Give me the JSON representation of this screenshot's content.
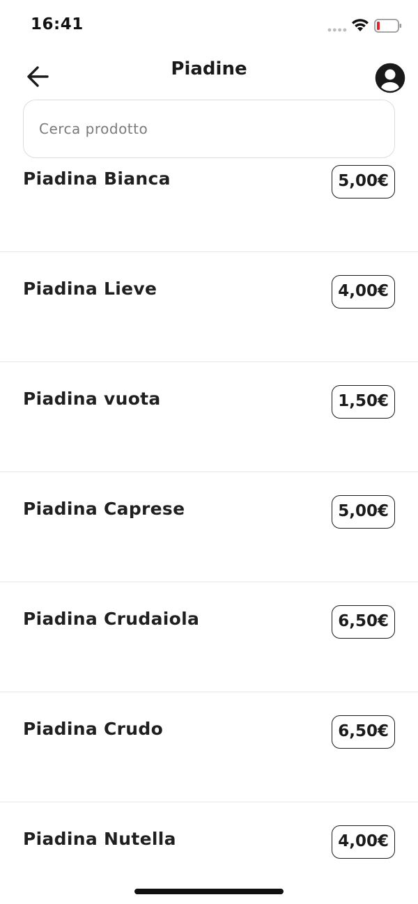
{
  "status_bar": {
    "time": "16:41",
    "icons": [
      "signal-icon",
      "wifi-icon",
      "battery-icon"
    ],
    "battery_color": "#e0242a"
  },
  "header": {
    "title": "Piadine",
    "back_icon": "arrow-left-icon",
    "profile_icon": "user-circle-icon"
  },
  "search": {
    "placeholder": "Cerca prodotto",
    "value": ""
  },
  "products": [
    {
      "name": "Piadina Bianca",
      "price": "5,00€"
    },
    {
      "name": "Piadina Lieve",
      "price": "4,00€"
    },
    {
      "name": "Piadina vuota",
      "price": "1,50€"
    },
    {
      "name": "Piadina Caprese",
      "price": "5,00€"
    },
    {
      "name": "Piadina Crudaiola",
      "price": "6,50€"
    },
    {
      "name": "Piadina Crudo",
      "price": "6,50€"
    },
    {
      "name": "Piadina Nutella",
      "price": "4,00€"
    }
  ]
}
